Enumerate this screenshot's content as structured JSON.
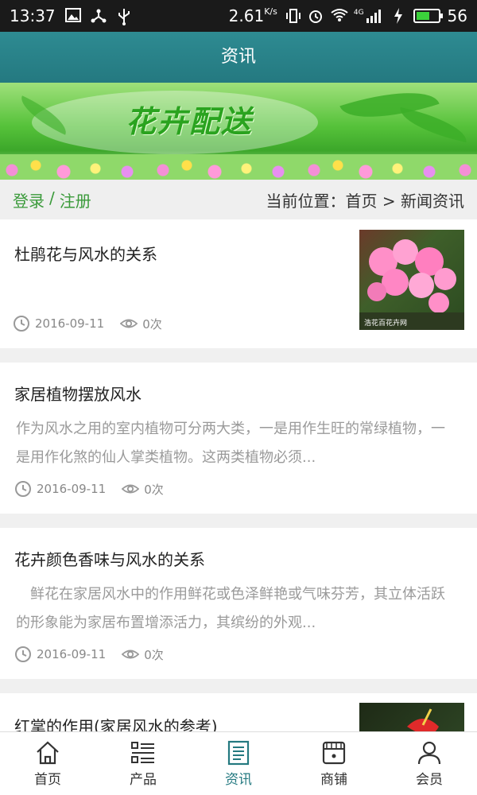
{
  "status_bar": {
    "time": "13:37",
    "speed": "2.61",
    "speed_unit": "K/s",
    "network": "4G",
    "battery": "56",
    "battery_level": 0.56
  },
  "header": {
    "title": "资讯"
  },
  "banner": {
    "slogan": "花卉配送"
  },
  "breadcrumb_bar": {
    "login": "登录",
    "separator": "/",
    "register": "注册",
    "location": "当前位置：首页 > 新闻资讯"
  },
  "articles": [
    {
      "title": "杜鹃花与风水的关系",
      "date": "2016-09-11",
      "views": "0次",
      "thumbnail": "pink-azalea-photo",
      "watermark": "浩花百花卉网"
    },
    {
      "title": "家居植物摆放风水",
      "summary": "作为风水之用的室内植物可分两大类，一是用作生旺的常绿植物，一是用作化煞的仙人掌类植物。这两类植物必须...",
      "date": "2016-09-11",
      "views": "0次"
    },
    {
      "title": "花卉颜色香味与风水的关系",
      "summary": "　鲜花在家居风水中的作用鲜花或色泽鲜艳或气味芬芳，其立体活跃的形象能为家居布置增添活力，其缤纷的外观...",
      "date": "2016-09-11",
      "views": "0次"
    },
    {
      "title": "红掌的作用(家居风水的参考)",
      "thumbnail": "red-anthurium-photo"
    }
  ],
  "bottom_nav": [
    {
      "label": "首页",
      "icon": "home-icon"
    },
    {
      "label": "产品",
      "icon": "list-icon"
    },
    {
      "label": "资讯",
      "icon": "news-icon",
      "active": true
    },
    {
      "label": "商铺",
      "icon": "shop-icon"
    },
    {
      "label": "会员",
      "icon": "user-icon"
    }
  ],
  "colors": {
    "header": "#247980",
    "accent_green": "#3a9a3a",
    "active_tab": "#247980"
  }
}
